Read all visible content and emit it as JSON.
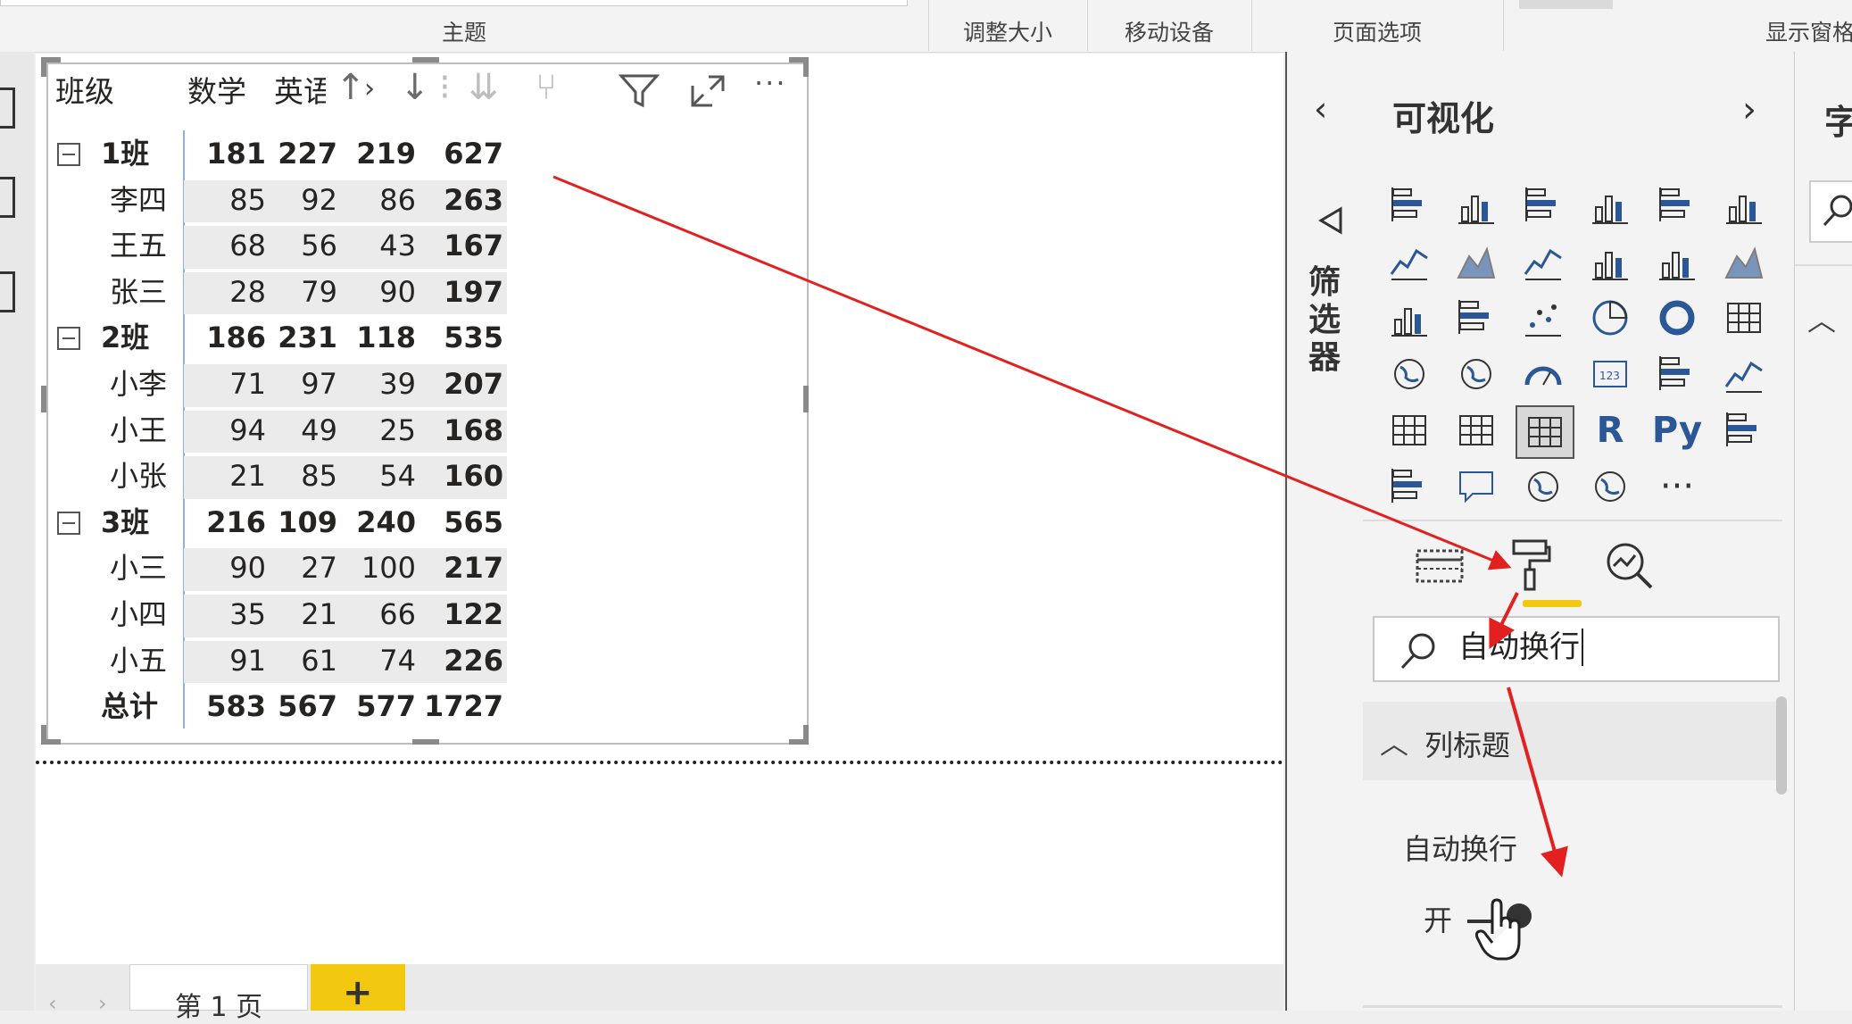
{
  "ribbon": {
    "theme": "主题",
    "resize": "调整大小",
    "mobile": "移动设备",
    "page_options": "页面选项",
    "show_pane": "显示窗格"
  },
  "visual": {
    "headers": [
      "班级",
      "数学",
      "英语"
    ],
    "rows": [
      {
        "label": "1班",
        "values": [
          "181",
          "227",
          "219",
          "627"
        ],
        "group": true
      },
      {
        "label": "李四",
        "values": [
          "85",
          "92",
          "86",
          "263"
        ],
        "group": false
      },
      {
        "label": "王五",
        "values": [
          "68",
          "56",
          "43",
          "167"
        ],
        "group": false
      },
      {
        "label": "张三",
        "values": [
          "28",
          "79",
          "90",
          "197"
        ],
        "group": false
      },
      {
        "label": "2班",
        "values": [
          "186",
          "231",
          "118",
          "535"
        ],
        "group": true
      },
      {
        "label": "小李",
        "values": [
          "71",
          "97",
          "39",
          "207"
        ],
        "group": false
      },
      {
        "label": "小王",
        "values": [
          "94",
          "49",
          "25",
          "168"
        ],
        "group": false
      },
      {
        "label": "小张",
        "values": [
          "21",
          "85",
          "54",
          "160"
        ],
        "group": false
      },
      {
        "label": "3班",
        "values": [
          "216",
          "109",
          "240",
          "565"
        ],
        "group": true
      },
      {
        "label": "小三",
        "values": [
          "90",
          "27",
          "100",
          "217"
        ],
        "group": false
      },
      {
        "label": "小四",
        "values": [
          "35",
          "21",
          "66",
          "122"
        ],
        "group": false
      },
      {
        "label": "小五",
        "values": [
          "91",
          "61",
          "74",
          "226"
        ],
        "group": false
      }
    ],
    "total": {
      "label": "总计",
      "values": [
        "583",
        "567",
        "577",
        "1727"
      ]
    }
  },
  "filters": {
    "label": "筛选器"
  },
  "viz_pane": {
    "title": "可视化",
    "search_value": "自动换行",
    "section": "列标题",
    "setting_label": "自动换行",
    "toggle_state": "开",
    "more": "···"
  },
  "fields_pane": {
    "title": "字"
  },
  "pages": {
    "tab": "第 1 页",
    "add": "+"
  },
  "colors": {
    "accent": "#f2c811",
    "arrow": "#e32020",
    "icon_blue": "#2b5797"
  }
}
